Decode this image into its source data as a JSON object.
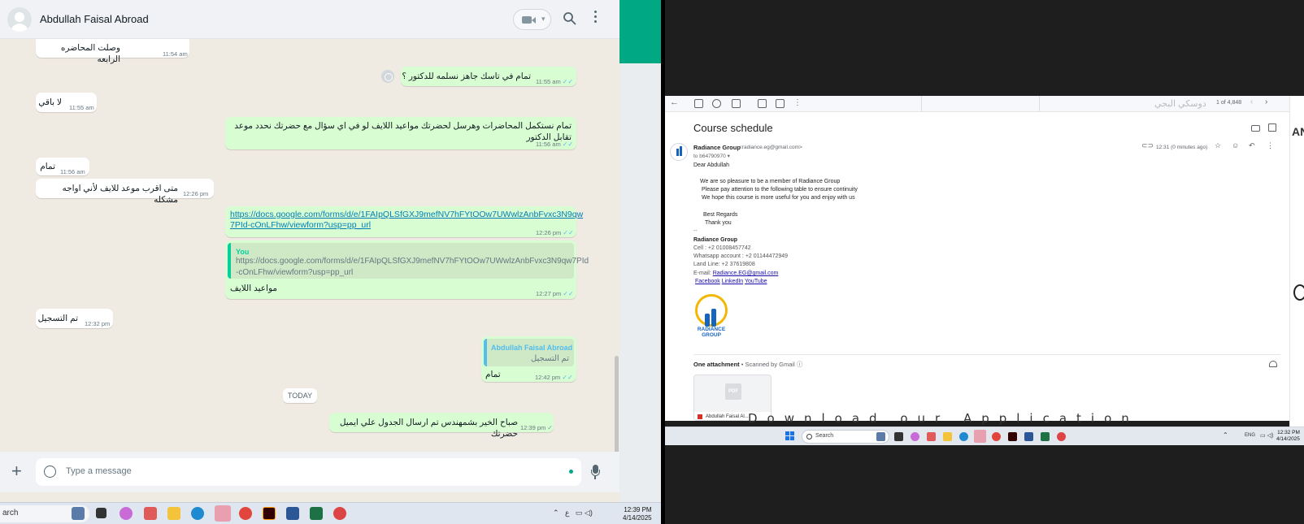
{
  "whatsapp": {
    "contact_name": "Abdullah Faisal Abroad",
    "messages": [
      {
        "dir": "in",
        "text": "وصلت المحاضره الرابعه",
        "time": "11:54 am"
      },
      {
        "dir": "out",
        "text": "تمام في تاسك جاهز نسلمه للدكتور ؟",
        "time": "11:55 am"
      },
      {
        "dir": "in",
        "text": "لا باقي",
        "time": "11:55 am"
      },
      {
        "dir": "out",
        "text": "تمام نستكمل المحاضرات وهرسل لحضرتك مواعيد اللايف لو في اي سؤال مع حضرتك نحدد موعد تقابل الدكتور",
        "time": "11:56 am"
      },
      {
        "dir": "in",
        "text": "تمام",
        "time": "11:56 am"
      },
      {
        "dir": "in",
        "text": "متى اقرب موعد للايف لأني اواجه مشكله",
        "time": "12:26 pm"
      },
      {
        "dir": "out",
        "link": "https://docs.google.com/forms/d/e/1FAIpQLSfGXJ9mefNV7hFYtOOw7UWwlzAnbFvxc3N9qw7PId-cOnLFhw/viewform?usp=pp_url",
        "link_line1": "https://docs.google.com/forms/d/e/1FAIpQLSfGXJ9mefNV7hFYtOOw7UWwlzAnbFvxc3N9qw",
        "link_line2": "7PId-cOnLFhw/viewform?usp=pp_url",
        "time": "12:26 pm"
      },
      {
        "dir": "out",
        "quote_author": "You",
        "quote_line1": "https://docs.google.com/forms/d/e/1FAIpQLSfGXJ9mefNV7hFYtOOw7UWwlzAnbFvxc3N9qw7PId",
        "quote_line2": "-cOnLFhw/viewform?usp=pp_url",
        "text": "مواعيد اللايف",
        "time": "12:27 pm"
      },
      {
        "dir": "in",
        "text": "تم التسجيل",
        "time": "12:32 pm"
      },
      {
        "dir": "out",
        "quote_author": "Abdullah Faisal Abroad",
        "quote_text": "تم التسجيل",
        "text": "تمام",
        "time": "12:42 pm"
      },
      {
        "dir": "out",
        "text": "صباح الخير بشمهندس تم ارسال الجدول علي ايميل حضرتك",
        "time": "12:39 pm"
      }
    ],
    "date_separator": "TODAY",
    "input_placeholder": "Type a message"
  },
  "taskbar_left": {
    "search_label": "arch",
    "time": "12:39 PM",
    "date": "4/14/2025",
    "lang": "ع"
  },
  "gmail": {
    "count": "1 of 4,848",
    "subject": "Course schedule",
    "sender_name": "Radiance Group",
    "sender_email": "<radiance.eg@gmail.com>",
    "to": "to b64790970 ▾",
    "time": "12:31 (0 minutes ago)",
    "body": {
      "greeting": "Dear  Abdullah",
      "line1": "We are so pleasure to be a member of Radiance Group",
      "line2": "Please pay attention to the following table to ensure continuity",
      "line3": "We hope this course is more useful for you and enjoy with us",
      "regards": "Best Regards",
      "thanks": "Thank you",
      "sep": "--",
      "sig_name": "Radiance Group",
      "cell": "Cell : +2 01008457742",
      "whatsapp": "Whatsapp account : +2 01144472949",
      "landline": "Land Line: +2 37619808",
      "email_label": "E-mail: ",
      "email_link": "Radiance.EG@gmail.com",
      "facebook": "Facebook",
      "linkedin": "LinkedIn",
      "youtube": "YouTube"
    },
    "logo_text_1": "RADIANCE",
    "logo_text_2": "GROUP",
    "attachment_heading": "One attachment",
    "attachment_scanned": " • Scanned by Gmail",
    "attachment_name": "Abdullah Faisal Al...",
    "attachment_badge": "PDF",
    "overlay_text": "Download our Application",
    "overlay_top": "دوسكي البجي"
  },
  "taskbar_right": {
    "search_label": "Search",
    "lang": "ENG",
    "time": "12:32 PM",
    "date": "4/14/2025"
  }
}
